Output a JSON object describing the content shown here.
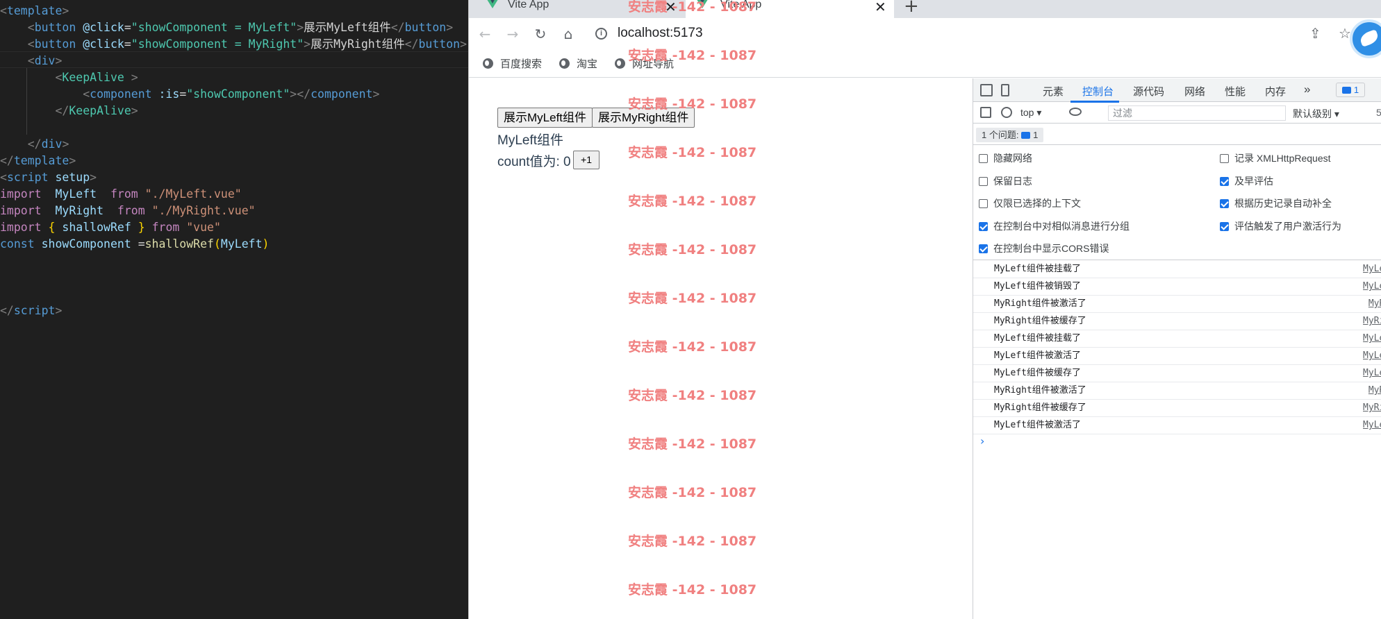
{
  "editor": {
    "lines": [
      [
        [
          "tk-punc",
          "<"
        ],
        [
          "tk-tag",
          "template"
        ],
        [
          "tk-punc",
          ">"
        ]
      ],
      [
        [
          "tk-text",
          "    "
        ],
        [
          "tk-punc",
          "<"
        ],
        [
          "tk-tag",
          "button "
        ],
        [
          "tk-attr",
          "@click"
        ],
        [
          "tk-text",
          "="
        ],
        [
          "tk-str",
          "\"showComponent = MyLeft\""
        ],
        [
          "tk-punc",
          ">"
        ],
        [
          "tk-text",
          "展示MyLeft组件"
        ],
        [
          "tk-punc",
          "</"
        ],
        [
          "tk-tag",
          "button"
        ],
        [
          "tk-punc",
          ">"
        ]
      ],
      [
        [
          "tk-text",
          "    "
        ],
        [
          "tk-punc",
          "<"
        ],
        [
          "tk-tag",
          "button "
        ],
        [
          "tk-attr",
          "@click"
        ],
        [
          "tk-text",
          "="
        ],
        [
          "tk-str",
          "\"showComponent = MyRight\""
        ],
        [
          "tk-punc",
          ">"
        ],
        [
          "tk-text",
          "展示MyRight组件"
        ],
        [
          "tk-punc",
          "</"
        ],
        [
          "tk-tag",
          "button"
        ],
        [
          "tk-punc",
          ">"
        ]
      ],
      [
        [
          "tk-text",
          "    "
        ],
        [
          "tk-punc",
          "<"
        ],
        [
          "tk-tag",
          "div"
        ],
        [
          "tk-punc",
          ">"
        ]
      ],
      [
        [
          "tk-text",
          "        "
        ],
        [
          "tk-punc",
          "<"
        ],
        [
          "tk-comp",
          "KeepAlive "
        ],
        [
          "tk-punc",
          ">"
        ]
      ],
      [
        [
          "tk-text",
          "            "
        ],
        [
          "tk-punc",
          "<"
        ],
        [
          "tk-tag",
          "component "
        ],
        [
          "tk-attr",
          ":is"
        ],
        [
          "tk-text",
          "="
        ],
        [
          "tk-str",
          "\"showComponent\""
        ],
        [
          "tk-punc",
          "></"
        ],
        [
          "tk-tag",
          "component"
        ],
        [
          "tk-punc",
          ">"
        ]
      ],
      [
        [
          "tk-text",
          "        "
        ],
        [
          "tk-punc",
          "</"
        ],
        [
          "tk-comp",
          "KeepAlive"
        ],
        [
          "tk-punc",
          ">"
        ]
      ],
      [],
      [
        [
          "tk-text",
          "    "
        ],
        [
          "tk-punc",
          "</"
        ],
        [
          "tk-tag",
          "div"
        ],
        [
          "tk-punc",
          ">"
        ]
      ],
      [
        [
          "tk-punc",
          "</"
        ],
        [
          "tk-tag",
          "template"
        ],
        [
          "tk-punc",
          ">"
        ]
      ],
      [
        [
          "tk-punc",
          "<"
        ],
        [
          "tk-tag",
          "script "
        ],
        [
          "tk-attr",
          "setup"
        ],
        [
          "tk-punc",
          ">"
        ]
      ],
      [
        [
          "tk-kw",
          "import  "
        ],
        [
          "tk-var",
          "MyLeft  "
        ],
        [
          "tk-kw",
          "from "
        ],
        [
          "tk-str2",
          "\"./MyLeft.vue\""
        ]
      ],
      [
        [
          "tk-kw",
          "import  "
        ],
        [
          "tk-var",
          "MyRight  "
        ],
        [
          "tk-kw",
          "from "
        ],
        [
          "tk-str2",
          "\"./MyRight.vue\""
        ]
      ],
      [
        [
          "tk-kw",
          "import "
        ],
        [
          "tk-brace",
          "{ "
        ],
        [
          "tk-var",
          "shallowRef "
        ],
        [
          "tk-brace",
          "} "
        ],
        [
          "tk-kw",
          "from "
        ],
        [
          "tk-str2",
          "\"vue\""
        ]
      ],
      [
        [
          "tk-decl",
          "const "
        ],
        [
          "tk-var",
          "showComponent "
        ],
        [
          "tk-text",
          "="
        ],
        [
          "tk-fn",
          "shallowRef"
        ],
        [
          "tk-brace",
          "("
        ],
        [
          "tk-var",
          "MyLeft"
        ],
        [
          "tk-brace",
          ")"
        ]
      ],
      [],
      [],
      [],
      [
        [
          "tk-punc",
          "</"
        ],
        [
          "tk-tag",
          "script"
        ],
        [
          "tk-punc",
          ">"
        ]
      ]
    ]
  },
  "browser": {
    "tabs": [
      {
        "title": "Vite App",
        "active": false
      },
      {
        "title": "Vite App",
        "active": true
      }
    ],
    "close_glyph": "✕",
    "new_tab_glyph": "+",
    "url": "localhost:5173",
    "nav": {
      "back": "←",
      "forward": "→",
      "reload": "↻",
      "home": "⌂"
    },
    "actions": {
      "share": "⇪",
      "bookmark": "☆"
    },
    "bookmarks": [
      "百度搜索",
      "淘宝",
      "网址导航"
    ]
  },
  "page": {
    "btn_left": "展示MyLeft组件",
    "btn_right": "展示MyRight组件",
    "component_title": "MyLeft组件",
    "count_label": "count值为: 0",
    "increment_label": "+1",
    "watermark": "安志霞 -142 - 1087"
  },
  "devtools": {
    "tabs": [
      "元素",
      "控制台",
      "源代码",
      "网络",
      "性能",
      "内存"
    ],
    "more_glyph": "»",
    "badge": "1",
    "context": "top ▾",
    "filter_placeholder": "过滤",
    "levels": "默认级别 ▾",
    "issues_count": "5",
    "issues_label": "1 个问题:",
    "issues_badge": "1",
    "settings_left": [
      {
        "label": "隐藏网络",
        "checked": false
      },
      {
        "label": "保留日志",
        "checked": false
      },
      {
        "label": "仅限已选择的上下文",
        "checked": false
      },
      {
        "label": "在控制台中对相似消息进行分组",
        "checked": true
      },
      {
        "label": "在控制台中显示CORS错误",
        "checked": true
      }
    ],
    "settings_right": [
      {
        "label": "记录 XMLHttpRequest",
        "checked": false
      },
      {
        "label": "及早评估",
        "checked": true
      },
      {
        "label": "根据历史记录自动补全",
        "checked": true
      },
      {
        "label": "评估触发了用户激活行为",
        "checked": true
      }
    ],
    "logs": [
      {
        "msg": "MyLeft组件被挂载了",
        "src": "MyLeft"
      },
      {
        "msg": "MyLeft组件被销毁了",
        "src": "MyLeft"
      },
      {
        "msg": "MyRight组件被激活了",
        "src": "MyRig"
      },
      {
        "msg": "MyRight组件被缓存了",
        "src": "MyRigh"
      },
      {
        "msg": "MyLeft组件被挂载了",
        "src": "MyLeft"
      },
      {
        "msg": "MyLeft组件被激活了",
        "src": "MyLeft"
      },
      {
        "msg": "MyLeft组件被缓存了",
        "src": "MyLeft"
      },
      {
        "msg": "MyRight组件被激活了",
        "src": "MyRig"
      },
      {
        "msg": "MyRight组件被缓存了",
        "src": "MyRigh"
      },
      {
        "msg": "MyLeft组件被激活了",
        "src": "MyLeft"
      }
    ],
    "prompt_glyph": "›"
  }
}
